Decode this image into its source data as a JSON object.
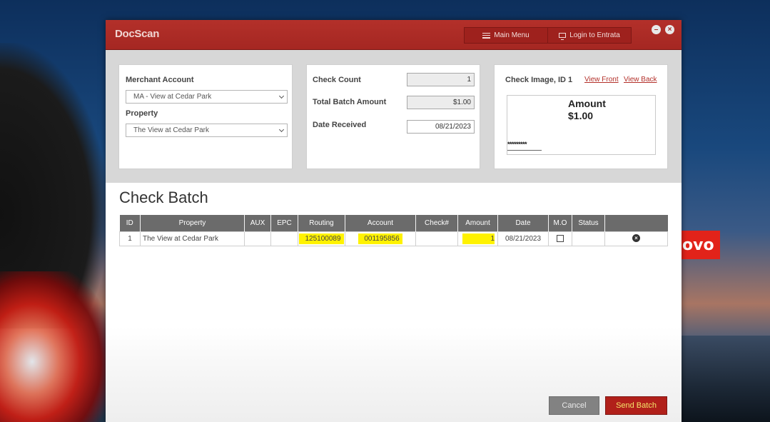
{
  "app": {
    "name": "DocScan",
    "menu": {
      "main_menu": "Main Menu",
      "login": "Login to Entrata"
    },
    "window_controls": {
      "minimize": "–",
      "close": "×"
    }
  },
  "desktop": {
    "brand_badge": "ovo"
  },
  "merchant_panel": {
    "merchant_label": "Merchant Account",
    "merchant_value": "MA - View at Cedar Park",
    "property_label": "Property",
    "property_value": "The View at Cedar Park"
  },
  "check_panel": {
    "count_label": "Check Count",
    "count_value": "1",
    "total_label": "Total Batch Amount",
    "total_value": "$1.00",
    "date_label": "Date Received",
    "date_value": "08/21/2023"
  },
  "image_panel": {
    "title": "Check Image, ID 1",
    "view_front": "View Front",
    "view_back": "View Back",
    "check_amount_label": "Amount",
    "check_amount_value": "$1.00",
    "check_stars": "*********"
  },
  "batch": {
    "title": "Check Batch",
    "columns": [
      "ID",
      "Property",
      "AUX",
      "EPC",
      "Routing",
      "Account",
      "Check#",
      "Amount",
      "Date",
      "M.O",
      "Status",
      ""
    ],
    "rows": [
      {
        "id": "1",
        "property": "The View at Cedar Park",
        "aux": "",
        "epc": "",
        "routing": "125100089",
        "account": "001195856",
        "check_no": "",
        "amount": "1",
        "date": "08/21/2023",
        "mo": false,
        "status": "",
        "delete_icon": "close-circle-icon"
      }
    ]
  },
  "actions": {
    "cancel": "Cancel",
    "send": "Send Batch"
  },
  "colors": {
    "brand": "#b3302a",
    "highlight": "#fff200",
    "header_gray": "#6b6b6b"
  }
}
